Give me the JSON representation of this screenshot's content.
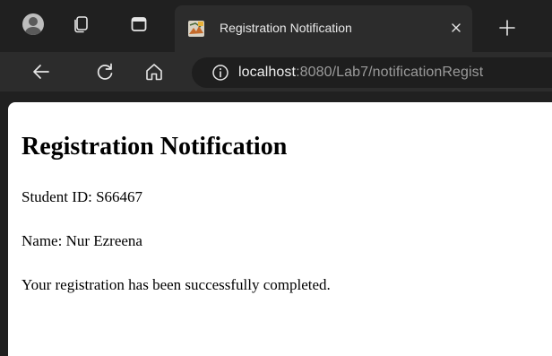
{
  "browser": {
    "tab": {
      "title": "Registration Notification",
      "favicon": "pdf-favicon-icon"
    },
    "toolbar": {
      "url_host": "localhost",
      "url_rest": ":8080/Lab7/notificationRegist"
    },
    "icons": {
      "avatar": "profile-avatar-icon",
      "collections": "collections-icon",
      "tab_actions": "tab-actions-icon",
      "close": "close-icon",
      "new_tab": "plus-icon",
      "back": "back-arrow-icon",
      "reload": "reload-icon",
      "home": "home-icon",
      "site_info": "info-icon"
    }
  },
  "page": {
    "heading": "Registration Notification",
    "student_id_line": "Student ID: S66467",
    "name_line": "Name: Nur Ezreena",
    "message": "Your registration has been successfully completed."
  },
  "colors": {
    "chrome_dark": "#202020",
    "toolbar": "#2c2c2c",
    "omnibox": "#1e1e1e",
    "page_bg": "#ffffff",
    "text": "#000000"
  }
}
